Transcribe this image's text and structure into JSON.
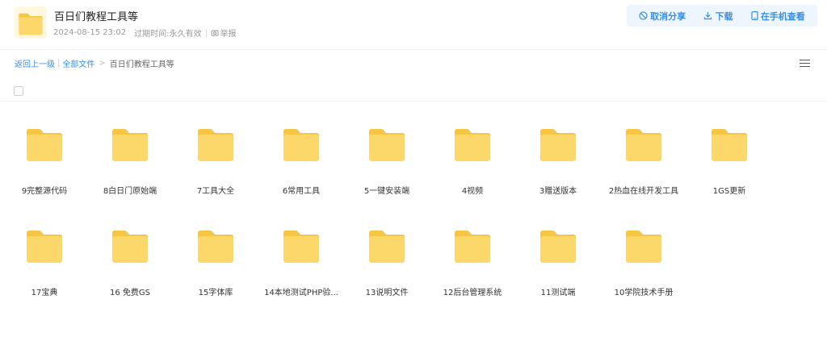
{
  "header": {
    "title": "百日们教程工具等",
    "date": "2024-08-15 23:02",
    "expire_label": "过期时间:",
    "expire_value": "永久有效",
    "report_label": "举报"
  },
  "actions": {
    "cancel_share": "取消分享",
    "download": "下载",
    "open_phone": "在手机查看"
  },
  "breadcrumb": {
    "back": "返回上一级",
    "all_files": "全部文件",
    "current": "百日们教程工具等"
  },
  "colors": {
    "accent": "#3a8ee6",
    "folder_body": "#fcd86b",
    "folder_tab": "#f6c544"
  },
  "folders": [
    "9完整源代码",
    "8白日门原始端",
    "7工具大全",
    "6常用工具",
    "5一键安装端",
    "4视频",
    "3赠送版本",
    "2热血在线开发工具",
    "1GS更新",
    "17宝典",
    "16 免费GS",
    "15字体库",
    "14本地测试PHP验...",
    "13说明文件",
    "12后台管理系统",
    "11测试端",
    "10学院技术手册"
  ]
}
